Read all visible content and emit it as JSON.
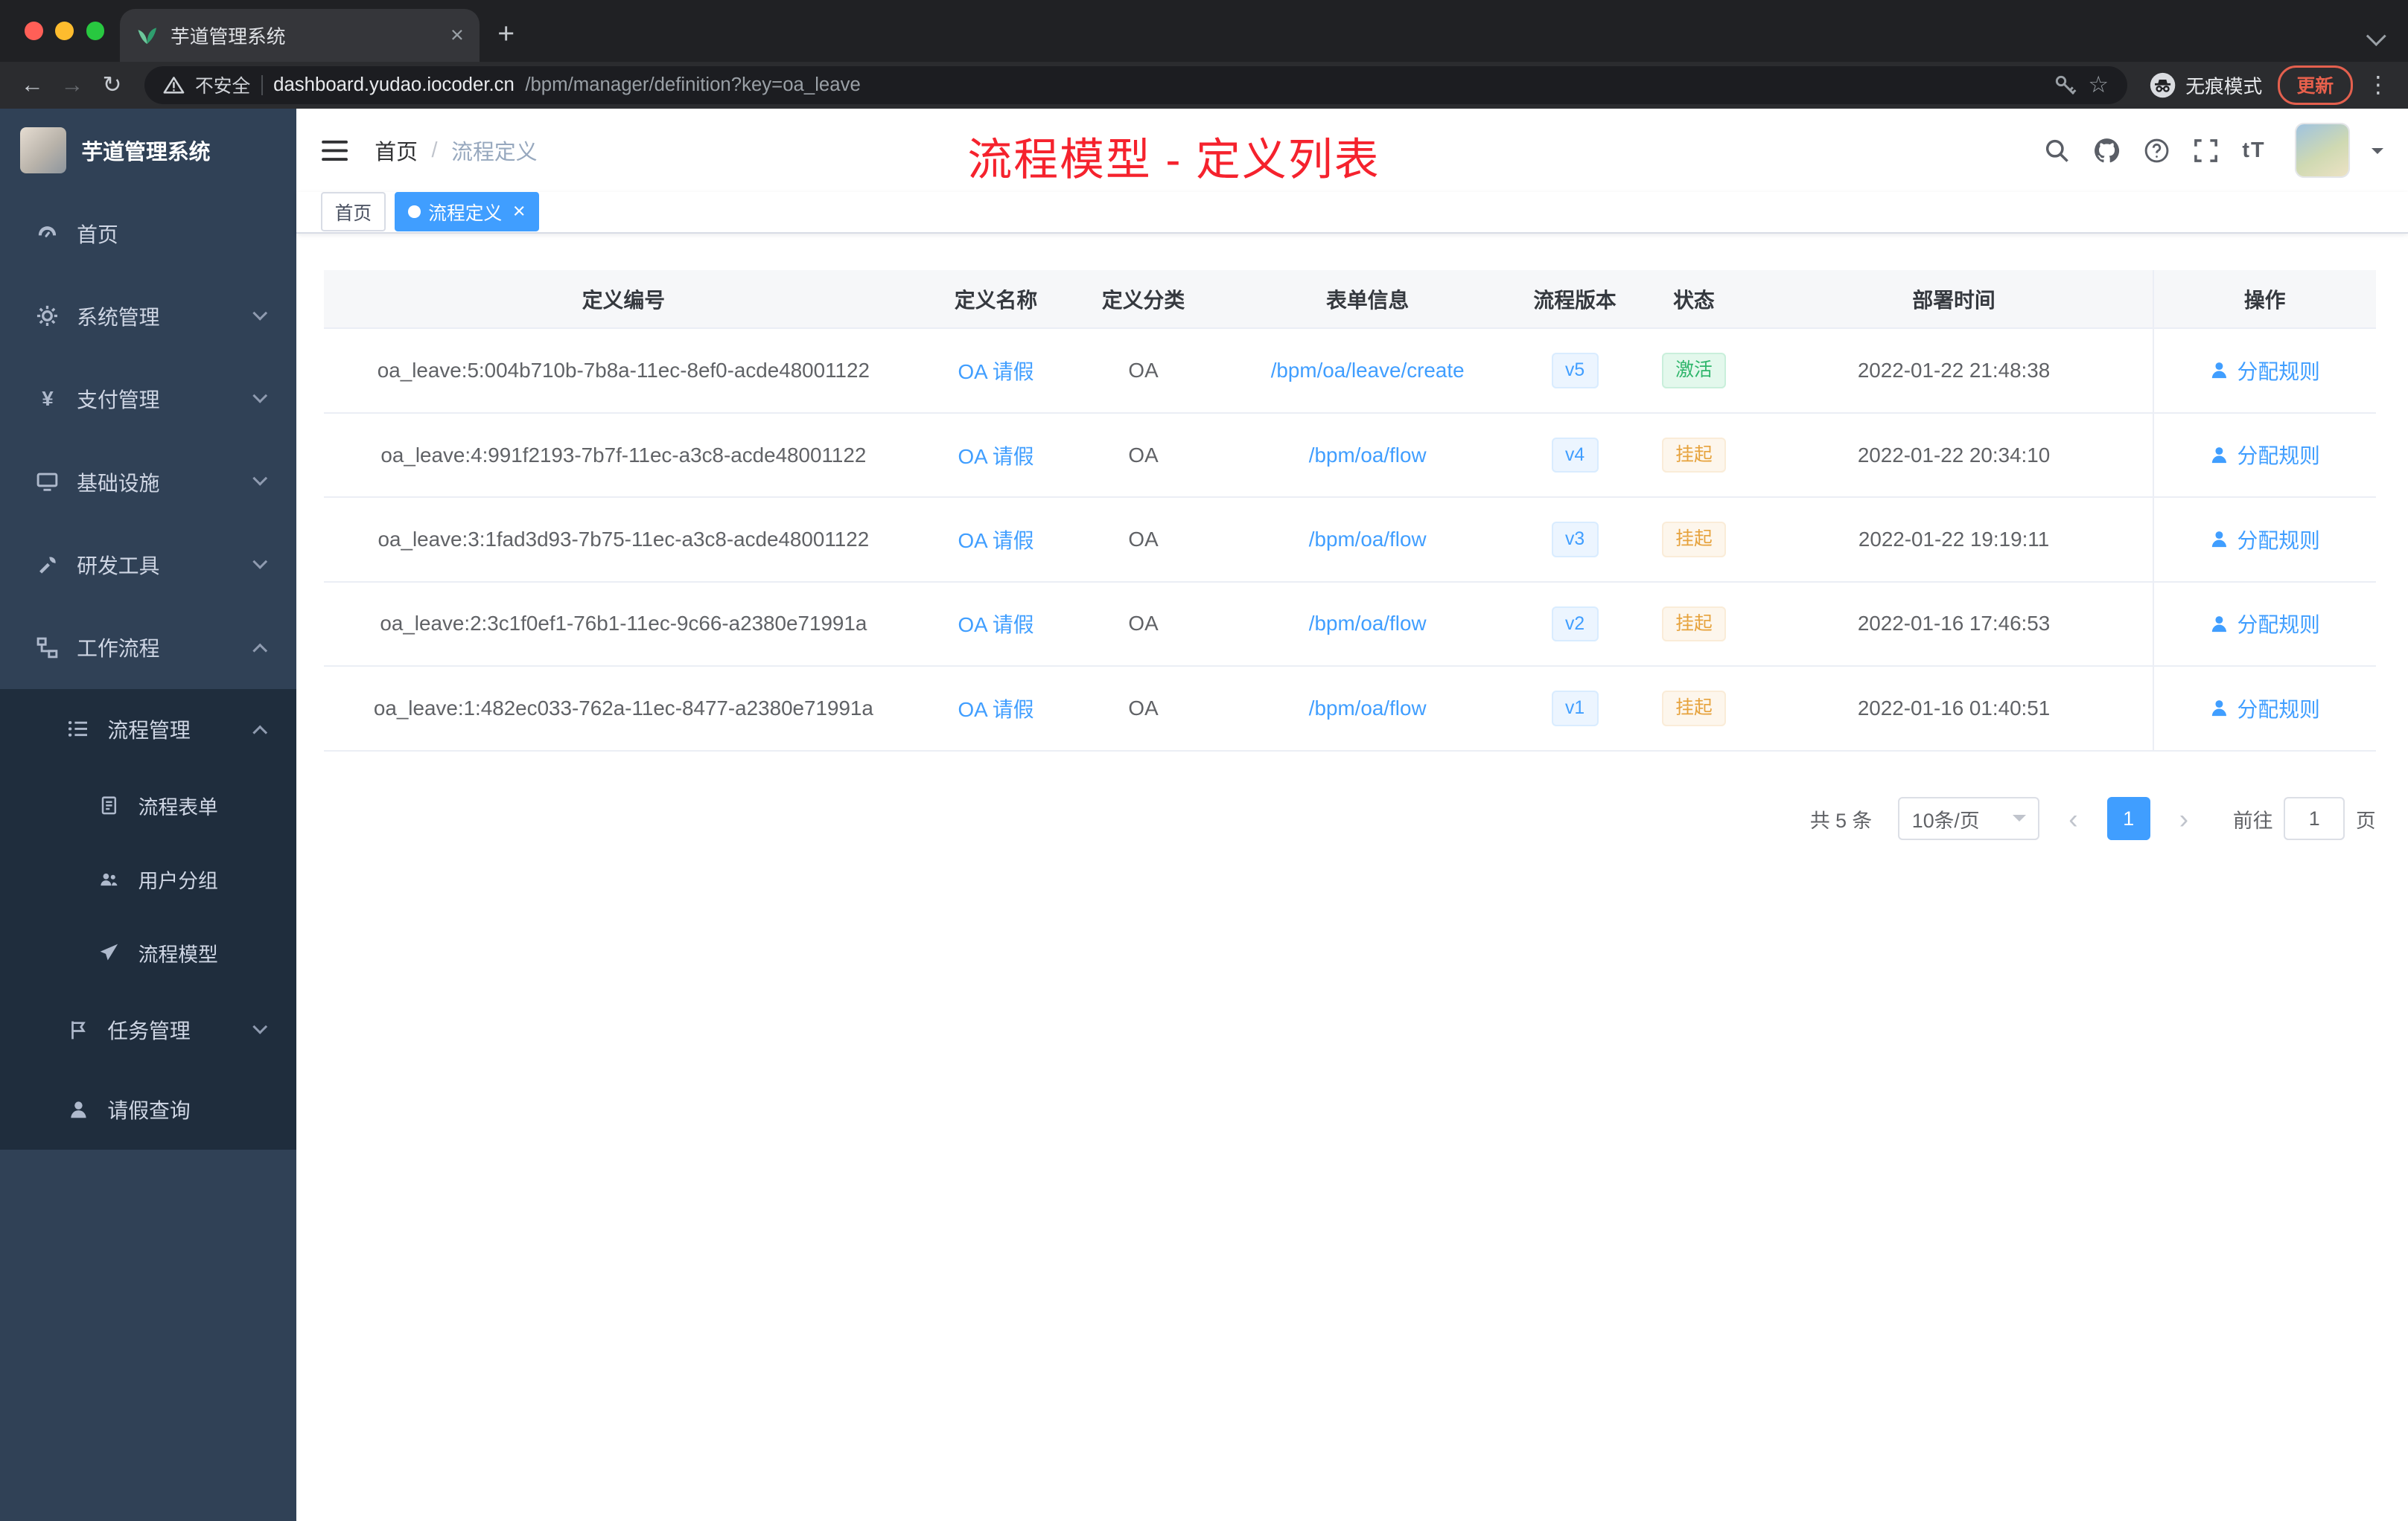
{
  "browser": {
    "tab_title": "芋道管理系统",
    "security_label": "不安全",
    "url_host": "dashboard.yudao.iocoder.cn",
    "url_path": "/bpm/manager/definition?key=oa_leave",
    "incognito_label": "无痕模式",
    "update_label": "更新"
  },
  "sidebar": {
    "app_title": "芋道管理系统",
    "items": [
      {
        "label": "首页",
        "icon": "dashboard-icon"
      },
      {
        "label": "系统管理",
        "icon": "gear-icon"
      },
      {
        "label": "支付管理",
        "icon": "yen-icon"
      },
      {
        "label": "基础设施",
        "icon": "infra-icon"
      },
      {
        "label": "研发工具",
        "icon": "tools-icon"
      },
      {
        "label": "工作流程",
        "icon": "workflow-icon"
      },
      {
        "label": "流程管理",
        "icon": "list-icon"
      },
      {
        "label": "流程表单",
        "icon": "form-icon"
      },
      {
        "label": "用户分组",
        "icon": "group-icon"
      },
      {
        "label": "流程模型",
        "icon": "model-icon"
      },
      {
        "label": "任务管理",
        "icon": "task-icon"
      },
      {
        "label": "请假查询",
        "icon": "user-icon"
      }
    ]
  },
  "header": {
    "breadcrumb_home": "首页",
    "breadcrumb_sep": "/",
    "breadcrumb_current": "流程定义",
    "annotation": "流程模型 - 定义列表",
    "font_size_tool": "tT"
  },
  "tags": {
    "home": "首页",
    "active": "流程定义"
  },
  "table": {
    "columns": [
      "定义编号",
      "定义名称",
      "定义分类",
      "表单信息",
      "流程版本",
      "状态",
      "部署时间",
      "操作"
    ],
    "action_label": "分配规则",
    "rows": [
      {
        "id": "oa_leave:5:004b710b-7b8a-11ec-8ef0-acde48001122",
        "name": "OA 请假",
        "category": "OA",
        "form": "/bpm/oa/leave/create",
        "version": "v5",
        "status": "激活",
        "status_type": "success",
        "deploy_time": "2022-01-22 21:48:38"
      },
      {
        "id": "oa_leave:4:991f2193-7b7f-11ec-a3c8-acde48001122",
        "name": "OA 请假",
        "category": "OA",
        "form": "/bpm/oa/flow",
        "version": "v4",
        "status": "挂起",
        "status_type": "warning",
        "deploy_time": "2022-01-22 20:34:10"
      },
      {
        "id": "oa_leave:3:1fad3d93-7b75-11ec-a3c8-acde48001122",
        "name": "OA 请假",
        "category": "OA",
        "form": "/bpm/oa/flow",
        "version": "v3",
        "status": "挂起",
        "status_type": "warning",
        "deploy_time": "2022-01-22 19:19:11"
      },
      {
        "id": "oa_leave:2:3c1f0ef1-76b1-11ec-9c66-a2380e71991a",
        "name": "OA 请假",
        "category": "OA",
        "form": "/bpm/oa/flow",
        "version": "v2",
        "status": "挂起",
        "status_type": "warning",
        "deploy_time": "2022-01-16 17:46:53"
      },
      {
        "id": "oa_leave:1:482ec033-762a-11ec-8477-a2380e71991a",
        "name": "OA 请假",
        "category": "OA",
        "form": "/bpm/oa/flow",
        "version": "v1",
        "status": "挂起",
        "status_type": "warning",
        "deploy_time": "2022-01-16 01:40:51"
      }
    ]
  },
  "pagination": {
    "total": "共 5 条",
    "page_size": "10条/页",
    "current_page": "1",
    "goto_label": "前往",
    "goto_value": "1",
    "goto_unit": "页"
  },
  "colors": {
    "accent_blue": "#409eff",
    "annotation_red": "#f5222d",
    "success_green": "#2db56a",
    "warning_orange": "#e6a23c"
  }
}
